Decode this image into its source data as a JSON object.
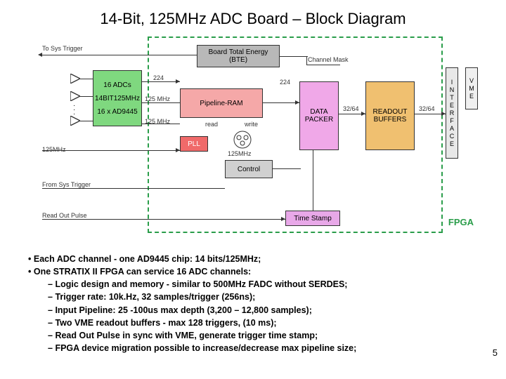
{
  "title": "14-Bit, 125MHz ADC Board – Block Diagram",
  "blocks": {
    "adc": {
      "l1": "16 ADCs",
      "l2": "14BIT125MHz",
      "l3": "16 x AD9445"
    },
    "bte": {
      "l1": "Board Total Energy",
      "l2": "(BTE)"
    },
    "pipeline": "Pipeline-RAM",
    "pll": "PLL",
    "control": "Control",
    "timestamp": "Time Stamp",
    "datapacker": {
      "l1": "DATA",
      "l2": "PACKER"
    },
    "readout": {
      "l1": "READOUT",
      "l2": "BUFFERS"
    },
    "interface": "INTERFACE",
    "vme": "VME",
    "fpga": "FPGA"
  },
  "labels": {
    "to_sys_trigger": "To Sys Trigger",
    "channel_mask": "Channel Mask",
    "bus224a": "224",
    "bus224b": "224",
    "clk125a": "125 MHz",
    "clk125b": "125 MHz",
    "clk125c": "125MHz",
    "clk125in": "125MHz",
    "read": "read",
    "write": "write",
    "from_sys": "From Sys Trigger",
    "readout_pulse": "Read Out Pulse",
    "bus32a": "32/64",
    "bus32b": "32/64"
  },
  "bullets": {
    "l1a": "Each ADC channel - one AD9445 chip: 14 bits/125MHz;",
    "l1b": "One STRATIX II FPGA can service 16 ADC channels:",
    "s1": "Logic design and memory - similar to 500MHz FADC without SERDES;",
    "s2": "Trigger rate: 10k.Hz, 32 samples/trigger (256ns);",
    "s3": "Input Pipeline: 25 -100us max depth (3,200 – 12,800 samples);",
    "s4": "Two VME readout buffers - max 128 triggers, (10 ms);",
    "s5": "Read Out Pulse in sync with VME, generate trigger time stamp;",
    "s6": "FPGA device migration possible to increase/decrease max pipeline size;"
  },
  "pagenum": "5"
}
